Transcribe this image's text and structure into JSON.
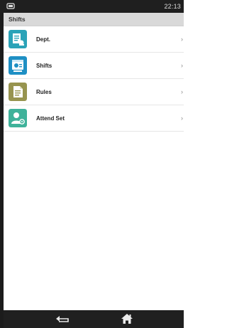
{
  "status_bar": {
    "time": "22:13"
  },
  "header": {
    "title": "Shifts"
  },
  "menu": {
    "items": [
      {
        "label": "Dept.",
        "icon": "department-icon",
        "color": "#2ba3b8"
      },
      {
        "label": "Shifts",
        "icon": "shift-schedule-icon",
        "color": "#1e8fc4"
      },
      {
        "label": "Rules",
        "icon": "rules-document-icon",
        "color": "#97944f"
      },
      {
        "label": "Attend Set",
        "icon": "attendance-settings-icon",
        "color": "#3fb29a"
      }
    ],
    "chevron": "›"
  },
  "nav": {
    "back_icon": "back-arrow-icon",
    "home_icon": "home-icon"
  }
}
